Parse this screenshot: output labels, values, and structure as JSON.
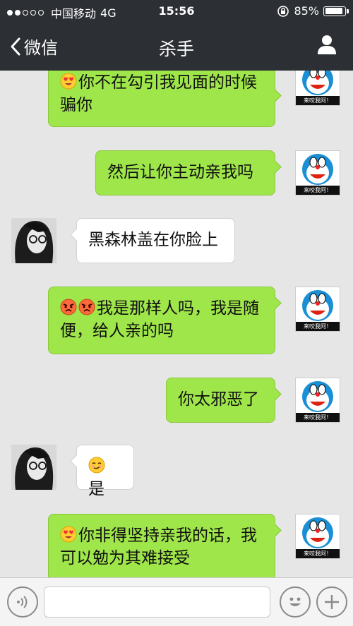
{
  "status_bar": {
    "carrier": "中国移动",
    "network": "4G",
    "time": "15:56",
    "battery": "85%",
    "signal_bars_filled": 2,
    "signal_bars_total": 5
  },
  "nav": {
    "back_label": "微信",
    "title": "杀手"
  },
  "messages": [
    {
      "side": "out",
      "emoji": "heart-eyes-emoji",
      "text": "你不在勾引我见面的时候骗你"
    },
    {
      "side": "out",
      "text": "然后让你主动亲我吗"
    },
    {
      "side": "in",
      "text": "黑森林盖在你脸上"
    },
    {
      "side": "out",
      "emoji": "angry-face-emoji x2",
      "text": "我是那样人吗，我是随便，给人亲的吗"
    },
    {
      "side": "out",
      "text": "你太邪恶了"
    },
    {
      "side": "in",
      "emoji": "smirk-face-emoji",
      "text": "是"
    },
    {
      "side": "out",
      "emoji": "heart-eyes-emoji",
      "text": "你非得坚持亲我的话，我可以勉为其难接受"
    }
  ],
  "avatar_me_caption": "来咬我阿！",
  "colors": {
    "bar_bg": "#2c2f33",
    "chat_bg": "#e6e6e6",
    "bubble_out": "#9fe64a",
    "bubble_in": "#ffffff"
  },
  "input_bar": {
    "left_icon": "voice-icon",
    "center_icon": "emoji-icon",
    "right_icon": "plus-icon",
    "input_value": ""
  }
}
